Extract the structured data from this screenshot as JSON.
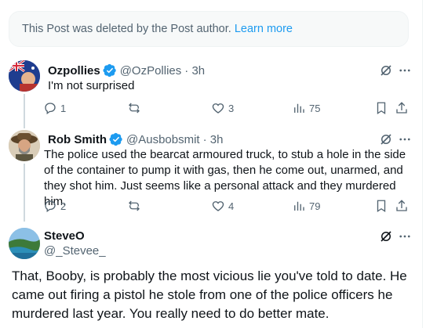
{
  "deleted_notice": {
    "text": "This Post was deleted by the Post author.",
    "link": "Learn more"
  },
  "posts": [
    {
      "author": "Ozpollies",
      "handle": "@OzPollies",
      "time": "· 3h",
      "text": "I'm not surprised",
      "replies": "1",
      "reposts": "",
      "likes": "3",
      "views": "75"
    },
    {
      "author": "Rob Smith",
      "handle": "@Ausbobsmit",
      "time": "· 3h",
      "text": "The police used the bearcat armoured truck, to stub a hole in the side of the container to pump it with gas, then he come out, unarmed, and they shot him. Just seems like a personal attack and they murdered him.",
      "replies": "2",
      "reposts": "",
      "likes": "4",
      "views": "79"
    },
    {
      "author": "SteveO",
      "handle": "@_Stevee_",
      "text": "That, Booby, is probably the most vicious lie you've told to date. He came out firing a pistol he stole from one of the police officers he murdered last year. You really need to do better mate."
    }
  ],
  "icons": {
    "verified": "verified-badge-icon",
    "grok": "grok-icon",
    "more": "more-icon",
    "reply": "reply-icon",
    "repost": "repost-icon",
    "like": "like-icon",
    "views": "views-icon",
    "bookmark": "bookmark-icon",
    "share": "share-icon"
  },
  "colors": {
    "accent": "#1d9bf0",
    "muted": "#536471",
    "text": "#0f1419"
  }
}
